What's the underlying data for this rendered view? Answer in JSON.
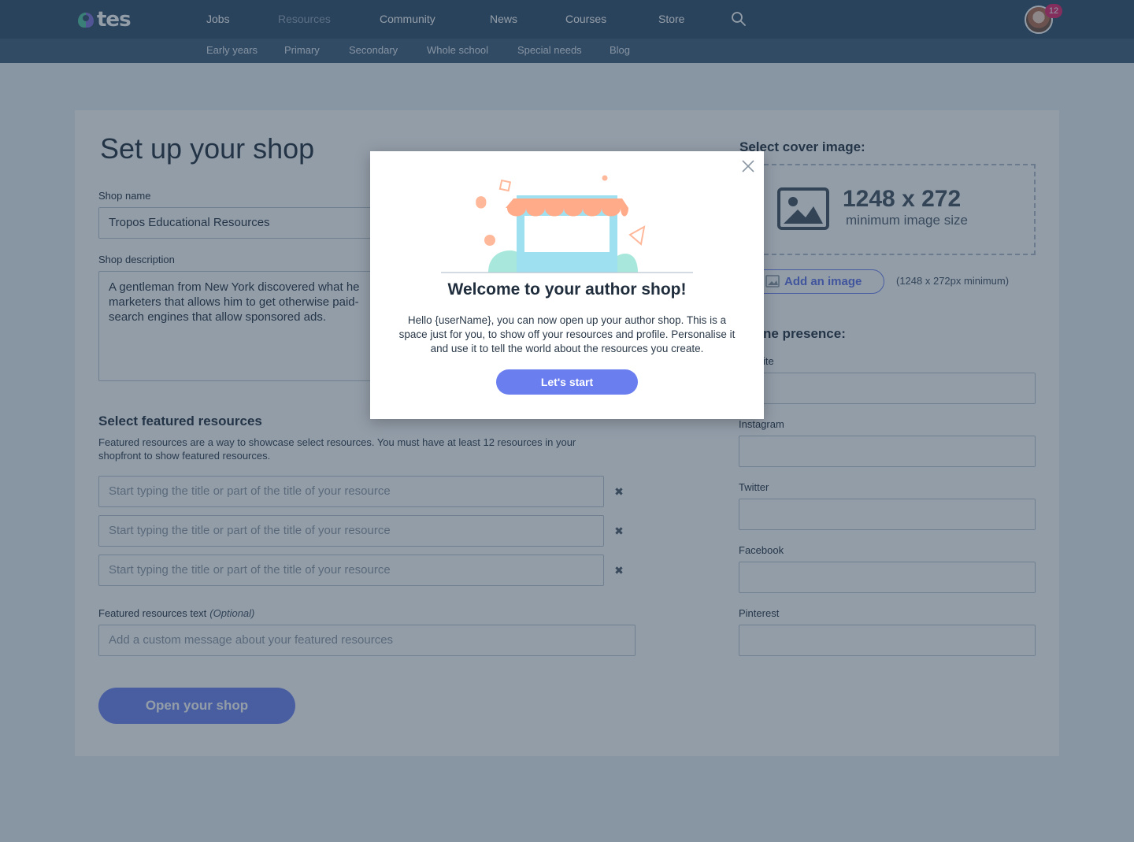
{
  "nav": {
    "logo": "tes",
    "items": [
      "Jobs",
      "Resources",
      "Community",
      "News",
      "Courses",
      "Store"
    ],
    "notification_count": "12",
    "sub_items": [
      "Early years",
      "Primary",
      "Secondary",
      "Whole school",
      "Special needs",
      "Blog"
    ]
  },
  "page": {
    "title": "Set up your shop",
    "shop_name_label": "Shop name",
    "shop_name_value": "Tropos Educational Resources",
    "shop_description_label": "Shop description",
    "shop_description_lines": [
      "A gentleman from New York discovered what he",
      "marketers that allows him to get otherwise paid-",
      "search engines that allow sponsored ads."
    ],
    "featured_title": "Select featured resources",
    "featured_help_lines": [
      "Featured resources are a way to showcase select resources. You must have at least 12 resources in your",
      "shopfront to show featured resources."
    ],
    "featured_placeholder": "Start typing the title or part of the title of your resource",
    "featured_text_label": "Featured resources text",
    "featured_text_optional": "(Optional)",
    "featured_text_placeholder": "Add a custom message about your featured resources",
    "open_shop_button": "Open your shop"
  },
  "sidebar": {
    "cover_title": "Select cover image:",
    "cover_size": "1248 x 272",
    "cover_min": "minimum image size",
    "add_image_button": "Add an image",
    "add_image_hint": "(1248 x 272px minimum)",
    "presence_title_visible": "ne presence:",
    "website_label_visible": "ite",
    "instagram_label": "Instagram",
    "twitter_label": "Twitter",
    "facebook_label": "Facebook",
    "pinterest_label": "Pinterest"
  },
  "modal": {
    "title": "Welcome to your author shop!",
    "body_lines": [
      "Hello {userName}, you can now open up your author shop. This is a",
      "space just for you, to show off your resources and profile. Personalise it",
      "and use it to tell the world about the resources you create."
    ],
    "button": "Let's start"
  },
  "colors": {
    "nav_bg": "#2c4a67",
    "subnav_bg": "#3a5a79",
    "accent": "#6b7ef0",
    "badge": "#e0206a",
    "awning": "#ffab8a",
    "stall": "#9fe0f0"
  }
}
